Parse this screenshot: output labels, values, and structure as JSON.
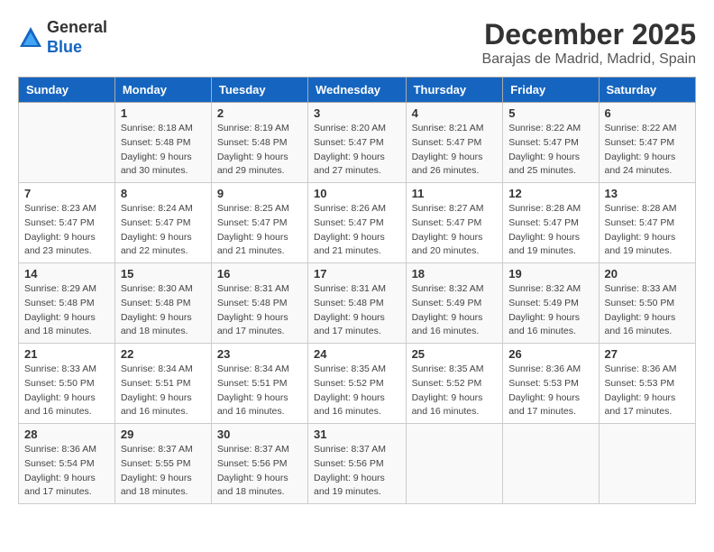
{
  "logo": {
    "general": "General",
    "blue": "Blue"
  },
  "title": "December 2025",
  "location": "Barajas de Madrid, Madrid, Spain",
  "days_of_week": [
    "Sunday",
    "Monday",
    "Tuesday",
    "Wednesday",
    "Thursday",
    "Friday",
    "Saturday"
  ],
  "weeks": [
    [
      {
        "day": "",
        "info": ""
      },
      {
        "day": "1",
        "info": "Sunrise: 8:18 AM\nSunset: 5:48 PM\nDaylight: 9 hours\nand 30 minutes."
      },
      {
        "day": "2",
        "info": "Sunrise: 8:19 AM\nSunset: 5:48 PM\nDaylight: 9 hours\nand 29 minutes."
      },
      {
        "day": "3",
        "info": "Sunrise: 8:20 AM\nSunset: 5:47 PM\nDaylight: 9 hours\nand 27 minutes."
      },
      {
        "day": "4",
        "info": "Sunrise: 8:21 AM\nSunset: 5:47 PM\nDaylight: 9 hours\nand 26 minutes."
      },
      {
        "day": "5",
        "info": "Sunrise: 8:22 AM\nSunset: 5:47 PM\nDaylight: 9 hours\nand 25 minutes."
      },
      {
        "day": "6",
        "info": "Sunrise: 8:22 AM\nSunset: 5:47 PM\nDaylight: 9 hours\nand 24 minutes."
      }
    ],
    [
      {
        "day": "7",
        "info": "Sunrise: 8:23 AM\nSunset: 5:47 PM\nDaylight: 9 hours\nand 23 minutes."
      },
      {
        "day": "8",
        "info": "Sunrise: 8:24 AM\nSunset: 5:47 PM\nDaylight: 9 hours\nand 22 minutes."
      },
      {
        "day": "9",
        "info": "Sunrise: 8:25 AM\nSunset: 5:47 PM\nDaylight: 9 hours\nand 21 minutes."
      },
      {
        "day": "10",
        "info": "Sunrise: 8:26 AM\nSunset: 5:47 PM\nDaylight: 9 hours\nand 21 minutes."
      },
      {
        "day": "11",
        "info": "Sunrise: 8:27 AM\nSunset: 5:47 PM\nDaylight: 9 hours\nand 20 minutes."
      },
      {
        "day": "12",
        "info": "Sunrise: 8:28 AM\nSunset: 5:47 PM\nDaylight: 9 hours\nand 19 minutes."
      },
      {
        "day": "13",
        "info": "Sunrise: 8:28 AM\nSunset: 5:47 PM\nDaylight: 9 hours\nand 19 minutes."
      }
    ],
    [
      {
        "day": "14",
        "info": "Sunrise: 8:29 AM\nSunset: 5:48 PM\nDaylight: 9 hours\nand 18 minutes."
      },
      {
        "day": "15",
        "info": "Sunrise: 8:30 AM\nSunset: 5:48 PM\nDaylight: 9 hours\nand 18 minutes."
      },
      {
        "day": "16",
        "info": "Sunrise: 8:31 AM\nSunset: 5:48 PM\nDaylight: 9 hours\nand 17 minutes."
      },
      {
        "day": "17",
        "info": "Sunrise: 8:31 AM\nSunset: 5:48 PM\nDaylight: 9 hours\nand 17 minutes."
      },
      {
        "day": "18",
        "info": "Sunrise: 8:32 AM\nSunset: 5:49 PM\nDaylight: 9 hours\nand 16 minutes."
      },
      {
        "day": "19",
        "info": "Sunrise: 8:32 AM\nSunset: 5:49 PM\nDaylight: 9 hours\nand 16 minutes."
      },
      {
        "day": "20",
        "info": "Sunrise: 8:33 AM\nSunset: 5:50 PM\nDaylight: 9 hours\nand 16 minutes."
      }
    ],
    [
      {
        "day": "21",
        "info": "Sunrise: 8:33 AM\nSunset: 5:50 PM\nDaylight: 9 hours\nand 16 minutes."
      },
      {
        "day": "22",
        "info": "Sunrise: 8:34 AM\nSunset: 5:51 PM\nDaylight: 9 hours\nand 16 minutes."
      },
      {
        "day": "23",
        "info": "Sunrise: 8:34 AM\nSunset: 5:51 PM\nDaylight: 9 hours\nand 16 minutes."
      },
      {
        "day": "24",
        "info": "Sunrise: 8:35 AM\nSunset: 5:52 PM\nDaylight: 9 hours\nand 16 minutes."
      },
      {
        "day": "25",
        "info": "Sunrise: 8:35 AM\nSunset: 5:52 PM\nDaylight: 9 hours\nand 16 minutes."
      },
      {
        "day": "26",
        "info": "Sunrise: 8:36 AM\nSunset: 5:53 PM\nDaylight: 9 hours\nand 17 minutes."
      },
      {
        "day": "27",
        "info": "Sunrise: 8:36 AM\nSunset: 5:53 PM\nDaylight: 9 hours\nand 17 minutes."
      }
    ],
    [
      {
        "day": "28",
        "info": "Sunrise: 8:36 AM\nSunset: 5:54 PM\nDaylight: 9 hours\nand 17 minutes."
      },
      {
        "day": "29",
        "info": "Sunrise: 8:37 AM\nSunset: 5:55 PM\nDaylight: 9 hours\nand 18 minutes."
      },
      {
        "day": "30",
        "info": "Sunrise: 8:37 AM\nSunset: 5:56 PM\nDaylight: 9 hours\nand 18 minutes."
      },
      {
        "day": "31",
        "info": "Sunrise: 8:37 AM\nSunset: 5:56 PM\nDaylight: 9 hours\nand 19 minutes."
      },
      {
        "day": "",
        "info": ""
      },
      {
        "day": "",
        "info": ""
      },
      {
        "day": "",
        "info": ""
      }
    ]
  ]
}
